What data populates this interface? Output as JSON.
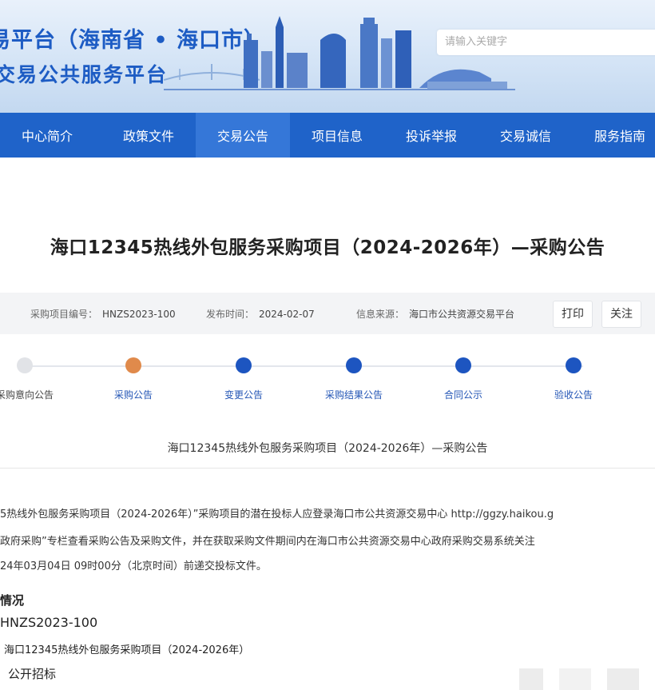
{
  "header": {
    "title_line1": "易平台（海南省 • 海口市）",
    "title_line2": "交易公共服务平台",
    "search_placeholder": "请输入关键字"
  },
  "nav": {
    "items": [
      "中心简介",
      "政策文件",
      "交易公告",
      "项目信息",
      "投诉举报",
      "交易诚信",
      "服务指南"
    ],
    "active_index": 2
  },
  "page_title": "海口12345热线外包服务采购项目（2024-2026年）—采购公告",
  "meta": {
    "project_no_label": "采购项目编号：",
    "project_no": "HNZS2023-100",
    "publish_label": "发布时间：",
    "publish_date": "2024-02-07",
    "source_label": "信息来源：",
    "source": "海口市公共资源交易平台",
    "print_label": "打印",
    "follow_label": "关注"
  },
  "steps": {
    "items": [
      "采购意向公告",
      "采购公告",
      "变更公告",
      "采购结果公告",
      "合同公示",
      "验收公告"
    ],
    "states": [
      "done",
      "current",
      "todo",
      "todo",
      "todo",
      "todo"
    ]
  },
  "notice": {
    "subtitle": "海口12345热线外包服务采购项目（2024-2026年）—采购公告",
    "para_line1": "5热线外包服务采购项目（2024-2026年）”采购项目的潜在投标人应登录海口市公共资源交易中心 http://ggzy.haikou.g",
    "para_line2": "政府采购”专栏查看采购公告及采购文件，并在获取采购文件期间内在海口市公共资源交易中心政府采购交易系统关注",
    "para_line3": "24年03月04日 09时00分（北京时间）前递交投标文件。",
    "section_heading": "情况",
    "project_no": "HNZS2023-100",
    "project_name": "海口12345热线外包服务采购项目（2024-2026年）",
    "method": "公开招标"
  },
  "colors": {
    "nav_bg": "#1f63c9",
    "brand": "#1d5cc4",
    "current_step": "#e08a4b",
    "todo_step": "#1d55c0"
  }
}
